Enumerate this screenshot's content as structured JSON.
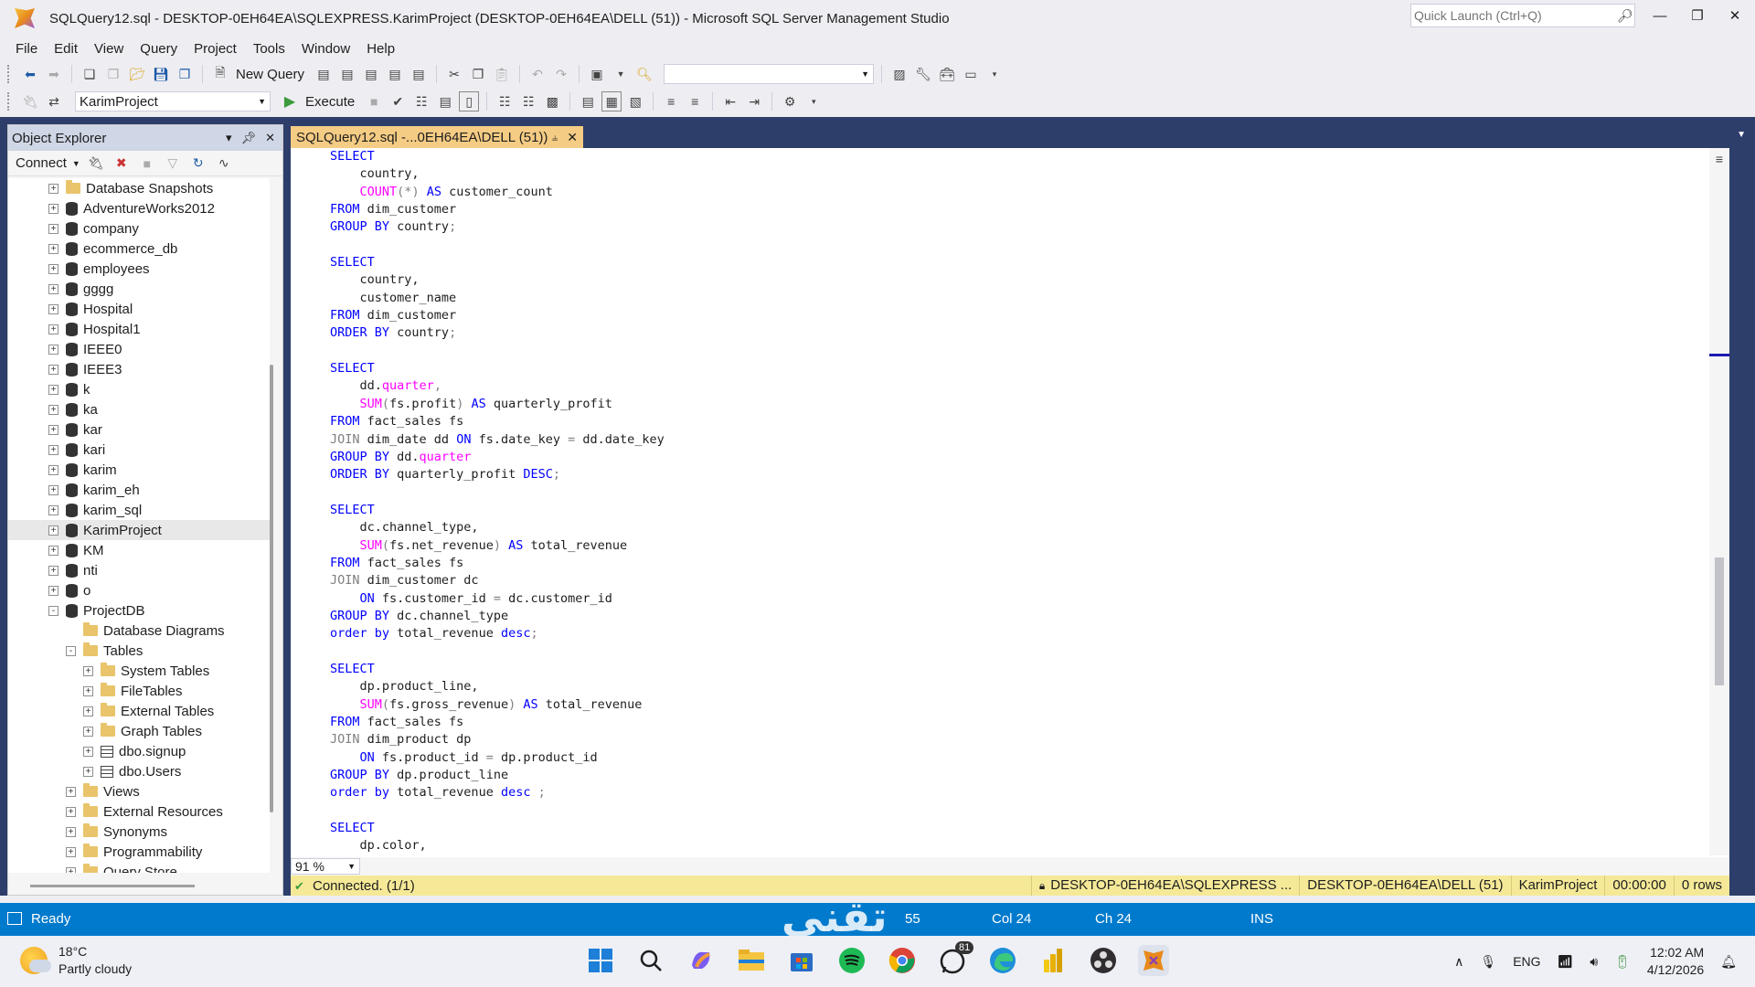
{
  "window": {
    "title": "SQLQuery12.sql - DESKTOP-0EH64EA\\SQLEXPRESS.KarimProject (DESKTOP-0EH64EA\\DELL (51)) - Microsoft SQL Server Management Studio",
    "quick_launch_placeholder": "Quick Launch (Ctrl+Q)"
  },
  "menu": [
    "File",
    "Edit",
    "View",
    "Query",
    "Project",
    "Tools",
    "Window",
    "Help"
  ],
  "toolbar": {
    "new_query": "New Query",
    "execute": "Execute",
    "database": "KarimProject"
  },
  "object_explorer": {
    "title": "Object Explorer",
    "connect": "Connect",
    "tree": [
      {
        "label": "Database Snapshots",
        "icon": "folder",
        "level": 0,
        "expander": "+"
      },
      {
        "label": "AdventureWorks2012",
        "icon": "database",
        "level": 0,
        "expander": "+"
      },
      {
        "label": "company",
        "icon": "database",
        "level": 0,
        "expander": "+"
      },
      {
        "label": "ecommerce_db",
        "icon": "database",
        "level": 0,
        "expander": "+"
      },
      {
        "label": "employees",
        "icon": "database",
        "level": 0,
        "expander": "+"
      },
      {
        "label": "gggg",
        "icon": "database",
        "level": 0,
        "expander": "+"
      },
      {
        "label": "Hospital",
        "icon": "database",
        "level": 0,
        "expander": "+"
      },
      {
        "label": "Hospital1",
        "icon": "database",
        "level": 0,
        "expander": "+"
      },
      {
        "label": "IEEE0",
        "icon": "database",
        "level": 0,
        "expander": "+"
      },
      {
        "label": "IEEE3",
        "icon": "database",
        "level": 0,
        "expander": "+"
      },
      {
        "label": "k",
        "icon": "database",
        "level": 0,
        "expander": "+"
      },
      {
        "label": "ka",
        "icon": "database",
        "level": 0,
        "expander": "+"
      },
      {
        "label": "kar",
        "icon": "database",
        "level": 0,
        "expander": "+"
      },
      {
        "label": "kari",
        "icon": "database",
        "level": 0,
        "expander": "+"
      },
      {
        "label": "karim",
        "icon": "database",
        "level": 0,
        "expander": "+"
      },
      {
        "label": "karim_eh",
        "icon": "database",
        "level": 0,
        "expander": "+"
      },
      {
        "label": "karim_sql",
        "icon": "database",
        "level": 0,
        "expander": "+"
      },
      {
        "label": "KarimProject",
        "icon": "database",
        "level": 0,
        "expander": "+",
        "selected": true
      },
      {
        "label": "KM",
        "icon": "database",
        "level": 0,
        "expander": "+"
      },
      {
        "label": "nti",
        "icon": "database",
        "level": 0,
        "expander": "+"
      },
      {
        "label": "o",
        "icon": "database",
        "level": 0,
        "expander": "+"
      },
      {
        "label": "ProjectDB",
        "icon": "database",
        "level": 0,
        "expander": "-"
      },
      {
        "label": "Database Diagrams",
        "icon": "folder",
        "level": 1,
        "expander": ""
      },
      {
        "label": "Tables",
        "icon": "folder",
        "level": 1,
        "expander": "-"
      },
      {
        "label": "System Tables",
        "icon": "folder",
        "level": 2,
        "expander": "+"
      },
      {
        "label": "FileTables",
        "icon": "folder",
        "level": 2,
        "expander": "+"
      },
      {
        "label": "External Tables",
        "icon": "folder",
        "level": 2,
        "expander": "+"
      },
      {
        "label": "Graph Tables",
        "icon": "folder",
        "level": 2,
        "expander": "+"
      },
      {
        "label": "dbo.signup",
        "icon": "table",
        "level": 2,
        "expander": "+"
      },
      {
        "label": "dbo.Users",
        "icon": "table",
        "level": 2,
        "expander": "+"
      },
      {
        "label": "Views",
        "icon": "folder",
        "level": 1,
        "expander": "+"
      },
      {
        "label": "External Resources",
        "icon": "folder",
        "level": 1,
        "expander": "+"
      },
      {
        "label": "Synonyms",
        "icon": "folder",
        "level": 1,
        "expander": "+"
      },
      {
        "label": "Programmability",
        "icon": "folder",
        "level": 1,
        "expander": "+"
      },
      {
        "label": "Query Store",
        "icon": "folder",
        "level": 1,
        "expander": "+"
      }
    ]
  },
  "editor": {
    "tab_label": "SQLQuery12.sql -...0EH64EA\\DELL (51))",
    "zoom": "91 %",
    "code_lines": [
      [
        [
          "kw",
          "SELECT"
        ]
      ],
      [
        [
          "ident",
          "    country,"
        ]
      ],
      [
        [
          "ident",
          "    "
        ],
        [
          "fn",
          "COUNT"
        ],
        [
          "gr",
          "("
        ],
        [
          "gr",
          "*"
        ],
        [
          "gr",
          ")"
        ],
        [
          "ident",
          " "
        ],
        [
          "kw",
          "AS"
        ],
        [
          "ident",
          " customer_count"
        ]
      ],
      [
        [
          "kw",
          "FROM"
        ],
        [
          "ident",
          " dim_customer"
        ]
      ],
      [
        [
          "kw",
          "GROUP BY"
        ],
        [
          "ident",
          " country"
        ],
        [
          "gr",
          ";"
        ]
      ],
      [
        [
          "ident",
          ""
        ]
      ],
      [
        [
          "kw",
          "SELECT"
        ]
      ],
      [
        [
          "ident",
          "    country,"
        ]
      ],
      [
        [
          "ident",
          "    customer_name"
        ]
      ],
      [
        [
          "kw",
          "FROM"
        ],
        [
          "ident",
          " dim_customer"
        ]
      ],
      [
        [
          "kw",
          "ORDER BY"
        ],
        [
          "ident",
          " country"
        ],
        [
          "gr",
          ";"
        ]
      ],
      [
        [
          "ident",
          ""
        ]
      ],
      [
        [
          "kw",
          "SELECT"
        ]
      ],
      [
        [
          "ident",
          "    dd."
        ],
        [
          "fn",
          "quarter"
        ],
        [
          "gr",
          ","
        ]
      ],
      [
        [
          "ident",
          "    "
        ],
        [
          "fn",
          "SUM"
        ],
        [
          "gr",
          "("
        ],
        [
          "ident",
          "fs.profit"
        ],
        [
          "gr",
          ")"
        ],
        [
          "ident",
          " "
        ],
        [
          "kw",
          "AS"
        ],
        [
          "ident",
          " quarterly_profit"
        ]
      ],
      [
        [
          "kw",
          "FROM"
        ],
        [
          "ident",
          " fact_sales fs"
        ]
      ],
      [
        [
          "gr",
          "JOIN"
        ],
        [
          "ident",
          " dim_date dd "
        ],
        [
          "kw",
          "ON"
        ],
        [
          "ident",
          " fs.date_key "
        ],
        [
          "gr",
          "="
        ],
        [
          "ident",
          " dd.date_key"
        ]
      ],
      [
        [
          "kw",
          "GROUP BY"
        ],
        [
          "ident",
          " dd."
        ],
        [
          "fn",
          "quarter"
        ]
      ],
      [
        [
          "kw",
          "ORDER BY"
        ],
        [
          "ident",
          " quarterly_profit "
        ],
        [
          "kw",
          "DESC"
        ],
        [
          "gr",
          ";"
        ]
      ],
      [
        [
          "ident",
          ""
        ]
      ],
      [
        [
          "kw",
          "SELECT"
        ]
      ],
      [
        [
          "ident",
          "    dc.channel_type,"
        ]
      ],
      [
        [
          "ident",
          "    "
        ],
        [
          "fn",
          "SUM"
        ],
        [
          "gr",
          "("
        ],
        [
          "ident",
          "fs.net_revenue"
        ],
        [
          "gr",
          ")"
        ],
        [
          "ident",
          " "
        ],
        [
          "kw",
          "AS"
        ],
        [
          "ident",
          " total_revenue"
        ]
      ],
      [
        [
          "kw",
          "FROM"
        ],
        [
          "ident",
          " fact_sales fs"
        ]
      ],
      [
        [
          "gr",
          "JOIN"
        ],
        [
          "ident",
          " dim_customer dc"
        ]
      ],
      [
        [
          "ident",
          "    "
        ],
        [
          "kw",
          "ON"
        ],
        [
          "ident",
          " fs.customer_id "
        ],
        [
          "gr",
          "="
        ],
        [
          "ident",
          " dc.customer_id"
        ]
      ],
      [
        [
          "kw",
          "GROUP BY"
        ],
        [
          "ident",
          " dc.channel_type"
        ]
      ],
      [
        [
          "kw",
          "order by"
        ],
        [
          "ident",
          " total_revenue "
        ],
        [
          "kw",
          "desc"
        ],
        [
          "gr",
          ";"
        ]
      ],
      [
        [
          "ident",
          ""
        ]
      ],
      [
        [
          "kw",
          "SELECT"
        ]
      ],
      [
        [
          "ident",
          "    dp.product_line,"
        ]
      ],
      [
        [
          "ident",
          "    "
        ],
        [
          "fn",
          "SUM"
        ],
        [
          "gr",
          "("
        ],
        [
          "ident",
          "fs.gross_revenue"
        ],
        [
          "gr",
          ")"
        ],
        [
          "ident",
          " "
        ],
        [
          "kw",
          "AS"
        ],
        [
          "ident",
          " total_revenue"
        ]
      ],
      [
        [
          "kw",
          "FROM"
        ],
        [
          "ident",
          " fact_sales fs"
        ]
      ],
      [
        [
          "gr",
          "JOIN"
        ],
        [
          "ident",
          " dim_product dp"
        ]
      ],
      [
        [
          "ident",
          "    "
        ],
        [
          "kw",
          "ON"
        ],
        [
          "ident",
          " fs.product_id "
        ],
        [
          "gr",
          "="
        ],
        [
          "ident",
          " dp.product_id"
        ]
      ],
      [
        [
          "kw",
          "GROUP BY"
        ],
        [
          "ident",
          " dp.product_line"
        ]
      ],
      [
        [
          "kw",
          "order by"
        ],
        [
          "ident",
          " total_revenue "
        ],
        [
          "kw",
          "desc"
        ],
        [
          "ident",
          " "
        ],
        [
          "gr",
          ";"
        ]
      ],
      [
        [
          "ident",
          ""
        ]
      ],
      [
        [
          "kw",
          "SELECT"
        ]
      ],
      [
        [
          "ident",
          "    dp.color,"
        ]
      ]
    ],
    "fold_lines": [
      0,
      6,
      12,
      20,
      29,
      38
    ]
  },
  "connection_bar": {
    "status": "Connected. (1/1)",
    "server": "DESKTOP-0EH64EA\\SQLEXPRESS ...",
    "user": "DESKTOP-0EH64EA\\DELL (51)",
    "database": "KarimProject",
    "elapsed": "00:00:00",
    "rows": "0 rows"
  },
  "status_bar": {
    "ready": "Ready",
    "ln": "55",
    "col": "Col 24",
    "ch": "Ch 24",
    "mode": "INS",
    "watermark": "تقنى"
  },
  "taskbar": {
    "temperature": "18°C",
    "weather": "Partly cloudy",
    "whatsapp_badge": "81",
    "language": "ENG",
    "time": "12:02 AM",
    "date": "4/12/2026"
  }
}
